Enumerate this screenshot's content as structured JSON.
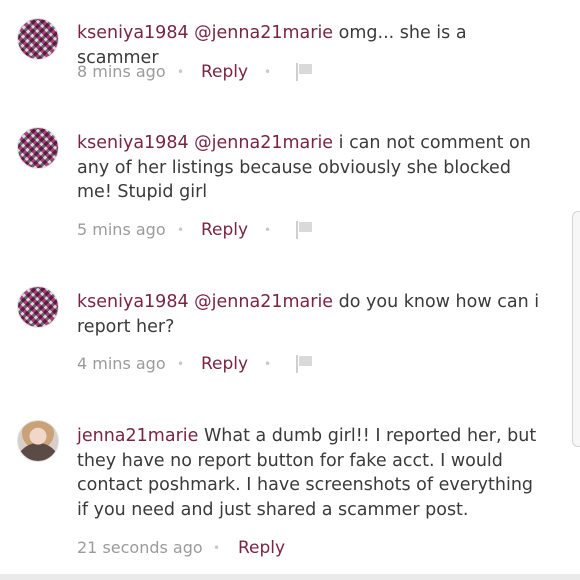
{
  "comments": [
    {
      "username": "kseniya1984",
      "mention": "@jenna21marie",
      "text": " omg... she is a scammer",
      "time": "8 mins ago",
      "reply_label": "Reply",
      "separator": "•",
      "avatar": "patterned-avatar"
    },
    {
      "username": "kseniya1984",
      "mention": "@jenna21marie",
      "text": " i can not comment on any of her listings because obviously she blocked me! Stupid girl",
      "time": "5 mins ago",
      "reply_label": "Reply",
      "separator": "•",
      "avatar": "patterned-avatar"
    },
    {
      "username": "kseniya1984",
      "mention": "@jenna21marie",
      "text": " do you know how can i report her?",
      "time": "4 mins ago",
      "reply_label": "Reply",
      "separator": "•",
      "avatar": "patterned-avatar"
    },
    {
      "username": "jenna21marie",
      "mention": "",
      "text": " What a dumb girl!! I reported her, but they have no report button for fake acct. I would contact poshmark. I have screenshots of everything if you need and just shared a scammer post.",
      "time": "21 seconds ago",
      "reply_label": "Reply",
      "separator": "•",
      "avatar": "photo-avatar"
    }
  ],
  "colors": {
    "link": "#7a2443",
    "body_text": "#3a3a3a",
    "meta_text": "#9b9b9b"
  },
  "icons": {
    "flag": "flag-icon"
  }
}
